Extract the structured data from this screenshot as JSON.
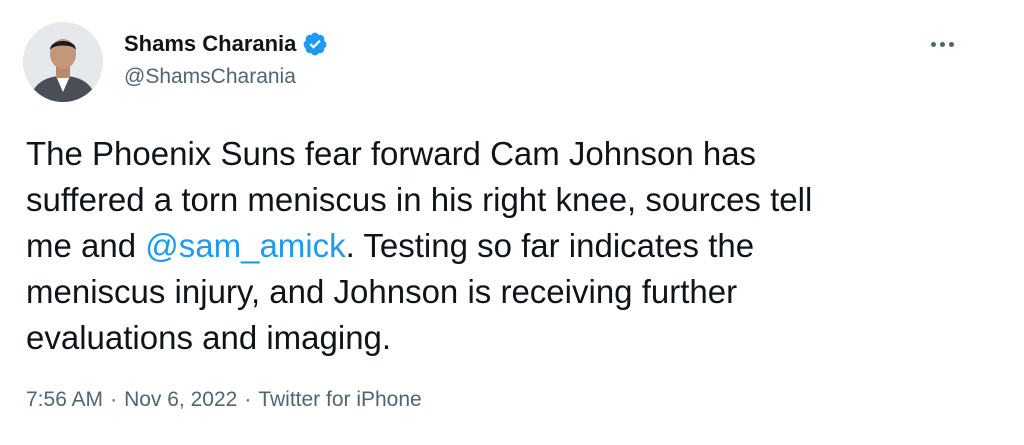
{
  "author": {
    "name": "Shams Charania",
    "handle": "@ShamsCharania"
  },
  "tweet": {
    "line1": "The Phoenix Suns fear forward Cam Johnson has",
    "line2": "suffered a torn meniscus in his right knee, sources tell",
    "line3_pre": "me and ",
    "mention": "@sam_amick",
    "line3_post": ". Testing so far indicates the",
    "line4": "meniscus injury, and Johnson is receiving further",
    "line5": "evaluations and imaging."
  },
  "meta": {
    "time": "7:56 AM",
    "separator": "·",
    "date": "Nov 6, 2022",
    "source": "Twitter for iPhone"
  },
  "icons": {
    "verified": "verified-badge-icon",
    "more": "more-options-icon"
  },
  "colors": {
    "text": "#0f1419",
    "secondary": "#536471",
    "link": "#1d9bf0",
    "verified": "#1d9bf0"
  }
}
